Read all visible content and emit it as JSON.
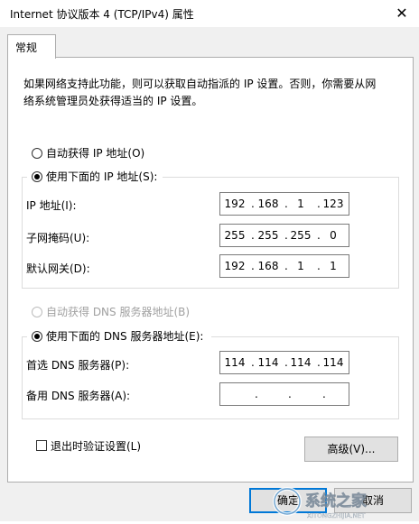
{
  "window": {
    "title": "Internet 协议版本 4 (TCP/IPv4) 属性",
    "close_glyph": "✕"
  },
  "tabs": [
    {
      "label": "常规"
    }
  ],
  "description": {
    "line1": "如果网络支持此功能，则可以获取自动指派的 IP 设置。否则，你需要从网",
    "line2": "络系统管理员处获得适当的 IP 设置。"
  },
  "ip": {
    "auto_label": "自动获得 IP 地址(O)",
    "manual_label": "使用下面的 IP 地址(S):",
    "selected": "manual",
    "fields": [
      {
        "label": "IP 地址(I):",
        "octets": [
          "192",
          "168",
          "1",
          "123"
        ]
      },
      {
        "label": "子网掩码(U):",
        "octets": [
          "255",
          "255",
          "255",
          "0"
        ]
      },
      {
        "label": "默认网关(D):",
        "octets": [
          "192",
          "168",
          "1",
          "1"
        ]
      }
    ]
  },
  "dns": {
    "auto_label": "自动获得 DNS 服务器地址(B)",
    "manual_label": "使用下面的 DNS 服务器地址(E):",
    "selected": "manual",
    "fields": [
      {
        "label": "首选 DNS 服务器(P):",
        "octets": [
          "114",
          "114",
          "114",
          "114"
        ]
      },
      {
        "label": "备用 DNS 服务器(A):",
        "octets": [
          "",
          "",
          "",
          ""
        ]
      }
    ]
  },
  "validate": {
    "label": "退出时验证设置(L)",
    "checked": false
  },
  "buttons": {
    "advanced": "高级(V)...",
    "ok": "确定",
    "cancel": "取消"
  },
  "watermark": {
    "text": "系统之家",
    "subtext": "XITONGZHIJIA.NET"
  },
  "colors": {
    "focus_border": "#0078d7",
    "dialog_bg": "#f0f0f0",
    "disabled_text": "#a0a0a0"
  }
}
